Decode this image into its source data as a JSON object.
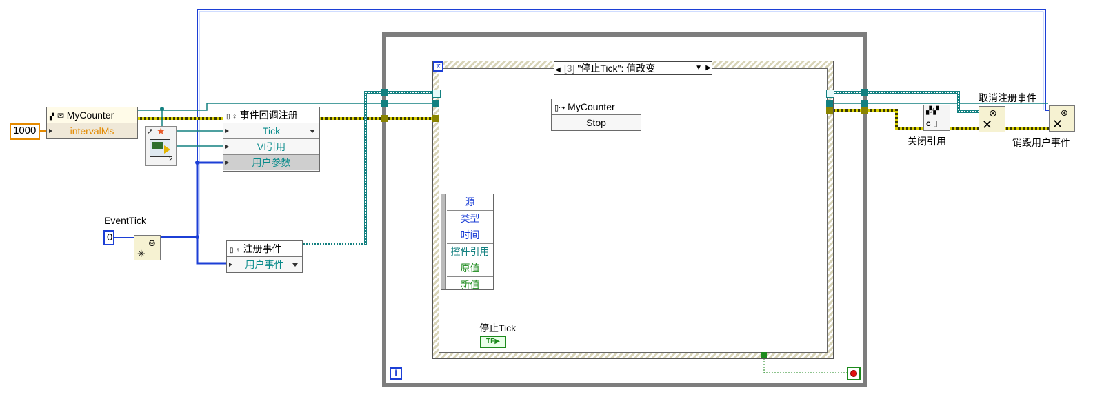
{
  "constants": {
    "interval": "1000",
    "event_tick_init": "0"
  },
  "mycounter_left": {
    "title": "MyCounter",
    "field": "intervalMs"
  },
  "register_callback": {
    "title": "事件回调注册",
    "rows": [
      "Tick",
      "VI引用",
      "用户参数"
    ]
  },
  "vi_ref_badge": "2",
  "event_tick_label": "EventTick",
  "register_events": {
    "title": "注册事件",
    "row": "用户事件"
  },
  "event_structure": {
    "case_index": "[3]",
    "case_label": "\"停止Tick\": 值改变",
    "event_data": [
      "源",
      "类型",
      "时间",
      "控件引用",
      "原值",
      "新值"
    ],
    "stop_control_label": "停止Tick",
    "bool_glyph": "TF"
  },
  "mycounter_inner": {
    "title": "MyCounter",
    "method": "Stop"
  },
  "close_ref_label": "关闭引用",
  "unregister_label": "取消注册事件",
  "destroy_label": "销毁用户事件",
  "loop_iteration_glyph": "i",
  "colors": {
    "wire_blue": "#1c3fd6",
    "wire_teal": "#138080",
    "wire_yellow": "#c9c100",
    "wire_green": "#1c8a1c",
    "loop_border": "#7a7a7a",
    "orange_const": "#e58a00"
  }
}
